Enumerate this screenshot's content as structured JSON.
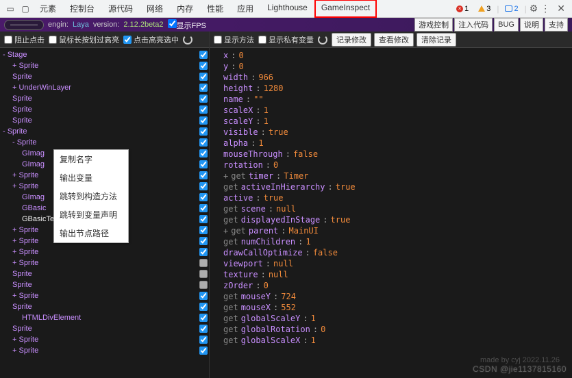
{
  "tabs": [
    "元素",
    "控制台",
    "源代码",
    "网络",
    "内存",
    "性能",
    "应用",
    "Lighthouse",
    "GameInspect"
  ],
  "activeTab": "GameInspect",
  "errors": {
    "err": "1",
    "warn": "3",
    "chat": "2"
  },
  "engine": {
    "badge": "————",
    "engin": "engin:",
    "laya": "Laya",
    "version": "version:",
    "vnum": "2.12.2beta2",
    "fps": "显示FPS"
  },
  "actionBtns": [
    "游戏控制",
    "注入代码",
    "BUG",
    "说明",
    "支持"
  ],
  "leftBar": {
    "block": "阻止点击",
    "hover": "鼠标长按划过高亮",
    "click": "点击高亮选中"
  },
  "rightBar": {
    "method": "显示方法",
    "private": "显示私有变量",
    "btns": [
      "记录修改",
      "查看修改",
      "清除记录"
    ]
  },
  "tree": [
    {
      "l": "- Stage",
      "i": 0,
      "c": true,
      "p": true
    },
    {
      "l": "+ Sprite",
      "i": 1,
      "c": true,
      "p": true
    },
    {
      "l": "Sprite",
      "i": 1,
      "c": true,
      "p": true
    },
    {
      "l": "+ UnderWinLayer",
      "i": 1,
      "c": true,
      "p": true
    },
    {
      "l": "Sprite",
      "i": 1,
      "c": true,
      "p": true
    },
    {
      "l": "Sprite",
      "i": 1,
      "c": true,
      "p": true
    },
    {
      "l": "Sprite",
      "i": 1,
      "c": true,
      "p": true
    },
    {
      "l": "- Sprite",
      "i": 0,
      "c": true,
      "p": true
    },
    {
      "l": "- Sprite",
      "i": 1,
      "c": true,
      "p": true
    },
    {
      "l": "GImag",
      "i": 2,
      "c": true,
      "p": true
    },
    {
      "l": "GImag",
      "i": 2,
      "c": true,
      "p": true
    },
    {
      "l": "+ Sprite",
      "i": 1,
      "c": true,
      "p": true
    },
    {
      "l": "+ Sprite",
      "i": 1,
      "c": true,
      "p": true
    },
    {
      "l": "GImag",
      "i": 2,
      "c": true,
      "p": true
    },
    {
      "l": "GBasic",
      "i": 2,
      "c": true,
      "p": true
    },
    {
      "l": "GBasicTextField",
      "i": 2,
      "c": true,
      "p": true,
      "off": true
    },
    {
      "l": "+ Sprite",
      "i": 1,
      "c": true,
      "p": true
    },
    {
      "l": "+ Sprite",
      "i": 1,
      "c": true,
      "p": true
    },
    {
      "l": "+ Sprite",
      "i": 1,
      "c": true,
      "p": true
    },
    {
      "l": "+ Sprite",
      "i": 1,
      "c": false,
      "p": false
    },
    {
      "l": "Sprite",
      "i": 1,
      "c": false,
      "p": false
    },
    {
      "l": "Sprite",
      "i": 1,
      "c": false,
      "p": false
    },
    {
      "l": "+ Sprite",
      "i": 1,
      "c": true,
      "p": true
    },
    {
      "l": "Sprite",
      "i": 1,
      "c": true,
      "p": true
    },
    {
      "l": "HTMLDivElement",
      "i": 2,
      "c": true,
      "p": true
    },
    {
      "l": "Sprite",
      "i": 1,
      "c": true,
      "p": true
    },
    {
      "l": "+ Sprite",
      "i": 1,
      "c": true,
      "p": true
    },
    {
      "l": "+ Sprite",
      "i": 1,
      "c": true,
      "p": true
    }
  ],
  "ctx": [
    "复制名字",
    "输出变量",
    "跳转到构造方法",
    "跳转到变量声明",
    "输出节点路径"
  ],
  "props": [
    {
      "k": "x",
      "v": "0"
    },
    {
      "k": "y",
      "v": "0"
    },
    {
      "k": "width",
      "v": "966"
    },
    {
      "k": "height",
      "v": "1280"
    },
    {
      "k": "name",
      "v": "\"\""
    },
    {
      "k": "scaleX",
      "v": "1"
    },
    {
      "k": "scaleY",
      "v": "1"
    },
    {
      "k": "visible",
      "v": "true"
    },
    {
      "k": "alpha",
      "v": "1"
    },
    {
      "k": "mouseThrough",
      "v": "false"
    },
    {
      "k": "rotation",
      "v": "0"
    },
    {
      "g": "get",
      "k": "timer",
      "v": "Timer",
      "plus": true
    },
    {
      "g": "get",
      "k": "activeInHierarchy",
      "v": "true"
    },
    {
      "k": "active",
      "v": "true"
    },
    {
      "g": "get",
      "k": "scene",
      "v": "null"
    },
    {
      "g": "get",
      "k": "displayedInStage",
      "v": "true"
    },
    {
      "g": "get",
      "k": "parent",
      "v": "MainUI",
      "plus": true
    },
    {
      "g": "get",
      "k": "numChildren",
      "v": "1"
    },
    {
      "k": "drawCallOptimize",
      "v": "false"
    },
    {
      "k": "viewport",
      "v": "null"
    },
    {
      "k": "texture",
      "v": "null"
    },
    {
      "k": "zOrder",
      "v": "0"
    },
    {
      "g": "get",
      "k": "mouseY",
      "v": "724"
    },
    {
      "g": "get",
      "k": "mouseX",
      "v": "552"
    },
    {
      "g": "get",
      "k": "globalScaleY",
      "v": "1"
    },
    {
      "g": "get",
      "k": "globalRotation",
      "v": "0"
    },
    {
      "g": "get",
      "k": "globalScaleX",
      "v": "1"
    }
  ],
  "watermark": "CSDN @jie1137815160",
  "watermark2": "made by cyj 2022.11.26"
}
